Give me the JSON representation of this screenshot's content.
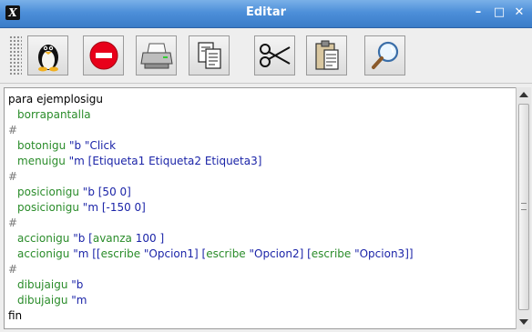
{
  "window": {
    "title": "Editar",
    "app_icon": "x-logo-icon",
    "controls": [
      {
        "name": "minimize",
        "glyph": "–"
      },
      {
        "name": "maximize",
        "glyph": "□"
      },
      {
        "name": "close",
        "glyph": "✕"
      }
    ]
  },
  "toolbar": {
    "buttons": [
      {
        "name": "penguin-button",
        "icon": "penguin-icon"
      },
      {
        "name": "stop-button",
        "icon": "stop-sign-icon"
      },
      {
        "name": "print-button",
        "icon": "printer-icon"
      },
      {
        "name": "copy-button",
        "icon": "copy-icon"
      },
      {
        "name": "cut-button",
        "icon": "scissors-icon"
      },
      {
        "name": "paste-button",
        "icon": "clipboard-icon"
      },
      {
        "name": "search-button",
        "icon": "magnifier-icon"
      }
    ]
  },
  "editor": {
    "lines": [
      {
        "indent": 0,
        "parts": [
          {
            "t": "para ejemplosigu",
            "c": "black"
          }
        ]
      },
      {
        "indent": 1,
        "parts": [
          {
            "t": "borrapantalla",
            "c": "green"
          }
        ]
      },
      {
        "indent": 0,
        "parts": [
          {
            "t": "#",
            "c": "gray"
          }
        ]
      },
      {
        "indent": 1,
        "parts": [
          {
            "t": "botonigu ",
            "c": "green"
          },
          {
            "t": "\"b \"Click",
            "c": "blue"
          }
        ]
      },
      {
        "indent": 1,
        "parts": [
          {
            "t": "menuigu ",
            "c": "green"
          },
          {
            "t": "\"m [Etiqueta1 Etiqueta2 Etiqueta3]",
            "c": "blue"
          }
        ]
      },
      {
        "indent": 0,
        "parts": [
          {
            "t": "#",
            "c": "gray"
          }
        ]
      },
      {
        "indent": 1,
        "parts": [
          {
            "t": "posicionigu ",
            "c": "green"
          },
          {
            "t": "\"b [50 0]",
            "c": "blue"
          }
        ]
      },
      {
        "indent": 1,
        "parts": [
          {
            "t": "posicionigu ",
            "c": "green"
          },
          {
            "t": "\"m [-150 0]",
            "c": "blue"
          }
        ]
      },
      {
        "indent": 0,
        "parts": [
          {
            "t": "#",
            "c": "gray"
          }
        ]
      },
      {
        "indent": 1,
        "parts": [
          {
            "t": "accionigu ",
            "c": "green"
          },
          {
            "t": "\"b [",
            "c": "blue"
          },
          {
            "t": "avanza",
            "c": "green"
          },
          {
            "t": " 100 ]",
            "c": "blue"
          }
        ]
      },
      {
        "indent": 1,
        "parts": [
          {
            "t": "accionigu ",
            "c": "green"
          },
          {
            "t": "\"m [[",
            "c": "blue"
          },
          {
            "t": "escribe",
            "c": "green"
          },
          {
            "t": " \"Opcion1] [",
            "c": "blue"
          },
          {
            "t": "escribe",
            "c": "green"
          },
          {
            "t": " \"Opcion2] [",
            "c": "blue"
          },
          {
            "t": "escribe",
            "c": "green"
          },
          {
            "t": " \"Opcion3]]",
            "c": "blue"
          }
        ]
      },
      {
        "indent": 0,
        "parts": [
          {
            "t": "#",
            "c": "gray"
          }
        ]
      },
      {
        "indent": 1,
        "parts": [
          {
            "t": "dibujaigu ",
            "c": "green"
          },
          {
            "t": "\"b",
            "c": "blue"
          }
        ]
      },
      {
        "indent": 1,
        "parts": [
          {
            "t": "dibujaigu ",
            "c": "green"
          },
          {
            "t": "\"m",
            "c": "blue"
          }
        ]
      },
      {
        "indent": 0,
        "parts": [
          {
            "t": "fin",
            "c": "black"
          }
        ]
      }
    ]
  },
  "colors": {
    "titlebar": "#4d8fd9",
    "keyword_green": "#2a8c2a",
    "argument_blue": "#1b24a8",
    "comment_gray": "#777777"
  }
}
